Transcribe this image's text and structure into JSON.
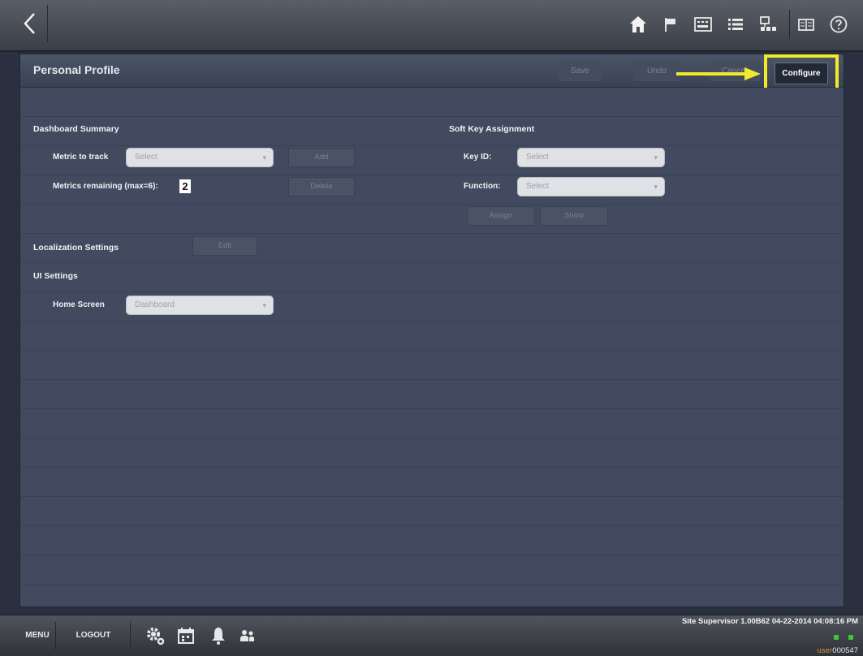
{
  "topbar": {
    "icons": [
      "back-icon",
      "home-icon",
      "flag-icon",
      "dashboard-icon",
      "list-icon",
      "network-icon",
      "book-icon",
      "help-icon"
    ]
  },
  "header": {
    "title": "Personal Profile",
    "buttons": {
      "save": "Save",
      "undo": "Undo",
      "cancel": "Cancel",
      "configure": "Configure"
    }
  },
  "dashboard_summary": {
    "heading": "Dashboard Summary",
    "metric_label": "Metric to track",
    "metric_value": "Select",
    "remaining_label": "Metrics remaining (max=6):",
    "remaining_value": "2",
    "add": "Add",
    "delete": "Delete"
  },
  "soft_key": {
    "heading": "Soft Key Assignment",
    "key_label": "Key ID:",
    "key_value": "Select",
    "function_label": "Function:",
    "function_value": "Select",
    "assign": "Assign",
    "show": "Show"
  },
  "localization": {
    "label": "Localization Settings",
    "edit": "Edit"
  },
  "ui_settings": {
    "heading": "UI Settings",
    "home_label": "Home Screen",
    "home_value": "Dashboard"
  },
  "bottombar": {
    "menu": "MENU",
    "logout": "LOGOUT",
    "icons": [
      "settings-icon",
      "calendar-icon",
      "alarm-bell-icon",
      "users-icon"
    ],
    "status": "Site Supervisor 1.00B62 04-22-2014 04:08:16 PM",
    "user_label": "user",
    "user_id": "000547"
  },
  "colors": {
    "highlight": "#f0ea2a",
    "background": "#3d4457",
    "status_ok": "#3ec43e"
  }
}
